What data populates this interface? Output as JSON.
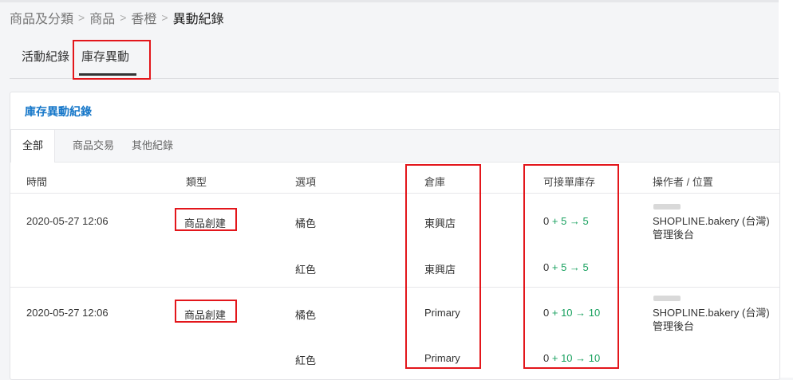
{
  "breadcrumb": {
    "item1": "商品及分類",
    "item2": "商品",
    "item3": "香橙",
    "current": "異動紀錄",
    "separator": ">"
  },
  "top_tabs": {
    "activity": "活動紀錄",
    "inventory": "庫存異動"
  },
  "card": {
    "title": "庫存異動紀錄",
    "subtabs": {
      "all": "全部",
      "transactions": "商品交易",
      "others": "其他紀錄"
    }
  },
  "table": {
    "headers": {
      "time": "時間",
      "type": "類型",
      "option": "選項",
      "warehouse": "倉庫",
      "stock": "可接單庫存",
      "operator": "操作者 / 位置"
    },
    "rows": [
      {
        "time": "2020-05-27 12:06",
        "type": "商品創建",
        "option": "橘色",
        "warehouse": "東興店",
        "base": "0",
        "delta": "+ 5 → 5",
        "op_line1": "SHOPLINE.bakery (台灣)",
        "op_line2": "管理後台"
      },
      {
        "time": "",
        "type": "",
        "option": "紅色",
        "warehouse": "東興店",
        "base": "0",
        "delta": "+ 5 → 5",
        "op_line1": "",
        "op_line2": ""
      },
      {
        "time": "2020-05-27 12:06",
        "type": "商品創建",
        "option": "橘色",
        "warehouse": "Primary",
        "base": "0",
        "delta": "+ 10 → 10",
        "op_line1": "SHOPLINE.bakery (台灣)",
        "op_line2": "管理後台"
      },
      {
        "time": "",
        "type": "",
        "option": "紅色",
        "warehouse": "Primary",
        "base": "0",
        "delta": "+ 10 → 10",
        "op_line1": "",
        "op_line2": ""
      }
    ]
  },
  "colors": {
    "accent_blue": "#1677c9",
    "positive_green": "#19a15f",
    "highlight_red": "#e3161b"
  }
}
